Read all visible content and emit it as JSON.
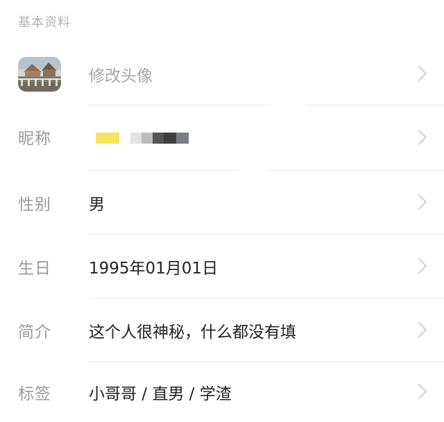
{
  "section": {
    "title": "基本资料"
  },
  "rows": {
    "avatar": {
      "value": "修改头像"
    },
    "nickname": {
      "label": "昵称"
    },
    "gender": {
      "label": "性别",
      "value": "男"
    },
    "birthday": {
      "label": "生日",
      "value": "1995年01月01日"
    },
    "bio": {
      "label": "简介",
      "value": "这个人很神秘，什么都没有填"
    },
    "tags": {
      "label": "标签",
      "value": "小哥哥 / 直男 / 学渣"
    }
  },
  "icons": {
    "chevron": "chevron-right-icon",
    "avatar": "avatar-photo"
  },
  "colors": {
    "label": "#9a9a9a",
    "value": "#222222",
    "muted": "#a6a6a6",
    "chevron": "#d2d2d2",
    "highlight": "#f6e45c"
  }
}
